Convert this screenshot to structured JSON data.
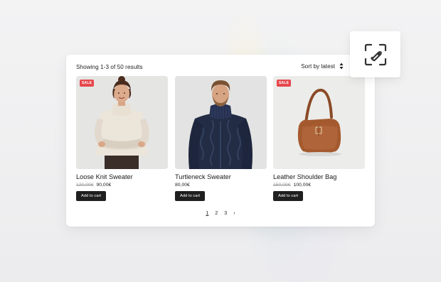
{
  "toolbar": {
    "results_text": "Showing 1-3 of 50 results",
    "sort_label": "Sort by latest"
  },
  "products": [
    {
      "name": "Loose Knit Sweater",
      "sale_badge": "SALE",
      "old_price": "120,00€",
      "price": "90,00€",
      "button_label": "Add to cart"
    },
    {
      "name": "Turtleneck Sweater",
      "price": "80,00€",
      "button_label": "Add to cart"
    },
    {
      "name": "Leather Shoulder Bag",
      "sale_badge": "SALE",
      "old_price": "150,00€",
      "price": "100,00€",
      "button_label": "Add to cart"
    }
  ],
  "pagination": {
    "pages": [
      "1",
      "2",
      "3"
    ],
    "next": "›",
    "current": "1"
  },
  "colors": {
    "sale": "#e5484d",
    "button": "#1f1f1f"
  },
  "icons": {
    "floating_action": "tag-scan-icon",
    "sort": "sort-arrows-icon"
  }
}
